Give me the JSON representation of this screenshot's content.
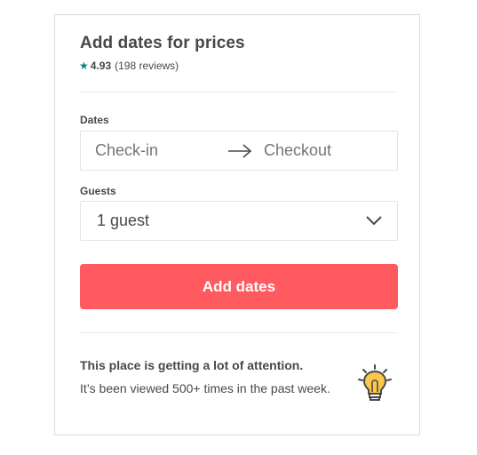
{
  "booking": {
    "title": "Add dates for prices",
    "rating": {
      "icon": "star-icon",
      "value": "4.93",
      "reviews": "(198 reviews)",
      "star_color": "#008489"
    },
    "dates": {
      "label": "Dates",
      "checkin_placeholder": "Check-in",
      "checkout_placeholder": "Checkout",
      "separator_icon": "arrow-right-icon"
    },
    "guests": {
      "label": "Guests",
      "value": "1 guest",
      "icon": "chevron-down-icon"
    },
    "submit": {
      "label": "Add dates",
      "color": "#ff5a5f"
    },
    "attention": {
      "title": "This place is getting a lot of attention.",
      "text": "It’s been viewed 500+ times in the past week.",
      "icon": "lightbulb-icon"
    }
  }
}
